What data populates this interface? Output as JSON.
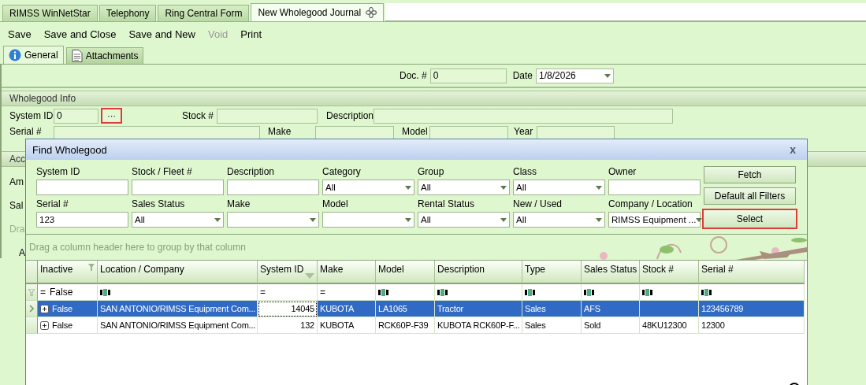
{
  "doc_tabs": [
    {
      "label": "RIMSS WinNetStar",
      "selected": false
    },
    {
      "label": "Telephony",
      "selected": false
    },
    {
      "label": "Ring Central Form",
      "selected": false
    },
    {
      "label": "New Wholegood Journal",
      "selected": true
    }
  ],
  "toolbar": [
    {
      "label": "Save",
      "disabled": false
    },
    {
      "label": "Save and Close",
      "disabled": false
    },
    {
      "label": "Save and New",
      "disabled": false
    },
    {
      "label": "Void",
      "disabled": true
    },
    {
      "label": "Print",
      "disabled": false
    }
  ],
  "form_tabs": [
    {
      "label": "General",
      "selected": true
    },
    {
      "label": "Attachments",
      "selected": false
    }
  ],
  "doc_number": {
    "label": "Doc. #",
    "value": "0"
  },
  "date": {
    "label": "Date",
    "value": "1/8/2026"
  },
  "wholegood_info": {
    "title": "Wholegood Info",
    "system_id": {
      "label": "System ID",
      "value": "0",
      "button": "···",
      "highlighted": true
    },
    "stock": {
      "label": "Stock #"
    },
    "description": {
      "label": "Description"
    },
    "serial": {
      "label": "Serial #"
    },
    "make": {
      "label": "Make"
    },
    "model": {
      "label": "Model"
    },
    "year": {
      "label": "Year"
    }
  },
  "covered": {
    "section_title": "Acc",
    "label_1": "Am",
    "label_2": "Sal",
    "grid_hint": "Dra",
    "grid_column": "A"
  },
  "dialog": {
    "title": "Find Wholegood",
    "close": "x",
    "filters": [
      {
        "label": "System ID",
        "kind": "text"
      },
      {
        "label": "Stock / Fleet #",
        "kind": "text"
      },
      {
        "label": "Description",
        "kind": "text"
      },
      {
        "label": "Category",
        "kind": "dropdown",
        "value": "All"
      },
      {
        "label": "Group",
        "kind": "dropdown",
        "value": "All"
      },
      {
        "label": "Class",
        "kind": "dropdown",
        "value": "All"
      },
      {
        "label": "Owner",
        "kind": "text"
      },
      {
        "label": "Serial #",
        "kind": "text",
        "value": "123"
      },
      {
        "label": "Sales Status",
        "kind": "dropdown",
        "value": "All"
      },
      {
        "label": "Make",
        "kind": "dropdown"
      },
      {
        "label": "Model",
        "kind": "dropdown"
      },
      {
        "label": "Rental Status",
        "kind": "dropdown",
        "value": "All"
      },
      {
        "label": "New / Used",
        "kind": "dropdown",
        "value": "All"
      },
      {
        "label": "Company / Location",
        "kind": "dropdown",
        "value": "RIMSS Equipment ..."
      }
    ],
    "buttons": [
      {
        "label": "Fetch",
        "highlighted": false
      },
      {
        "label": "Default all Filters",
        "highlighted": false
      },
      {
        "label": "Select",
        "highlighted": true
      }
    ],
    "group_hint": "Drag a column header here to group by that column",
    "columns": [
      {
        "label": "Inactive",
        "filtered": true,
        "sorted": false
      },
      {
        "label": "Location / Company",
        "filtered": false,
        "sorted": false
      },
      {
        "label": "System ID",
        "filtered": false,
        "sorted": true
      },
      {
        "label": "Make",
        "filtered": false,
        "sorted": false
      },
      {
        "label": "Model",
        "filtered": false,
        "sorted": false
      },
      {
        "label": "Description",
        "filtered": false,
        "sorted": false
      },
      {
        "label": "Type",
        "filtered": false,
        "sorted": false
      },
      {
        "label": "Sales Status",
        "filtered": false,
        "sorted": false
      },
      {
        "label": "Stock #",
        "filtered": false,
        "sorted": false
      },
      {
        "label": "Serial #",
        "filtered": false,
        "sorted": false
      }
    ],
    "filter_row": [
      {
        "kind": "equals",
        "symbol": "=",
        "value": "False"
      },
      {
        "kind": "contains"
      },
      {
        "kind": "equals",
        "symbol": "="
      },
      {
        "kind": "equals",
        "symbol": "="
      },
      {
        "kind": "contains"
      },
      {
        "kind": "contains"
      },
      {
        "kind": "contains"
      },
      {
        "kind": "contains"
      },
      {
        "kind": "contains"
      },
      {
        "kind": "contains"
      }
    ],
    "rows": [
      {
        "selected": true,
        "cells": [
          "False",
          "SAN ANTONIO/RIMSS Equipment Com...",
          "14045",
          "KUBOTA",
          "LA1065",
          "Tractor",
          "Sales",
          "AFS",
          "",
          "123456789"
        ]
      },
      {
        "selected": false,
        "cells": [
          "False",
          "SAN ANTONIO/RIMSS Equipment Com...",
          "132",
          "KUBOTA",
          "RCK60P-F39",
          "KUBOTA RCK60P-F...",
          "Sales",
          "Sold",
          "48KU12300",
          "12300"
        ]
      }
    ]
  }
}
